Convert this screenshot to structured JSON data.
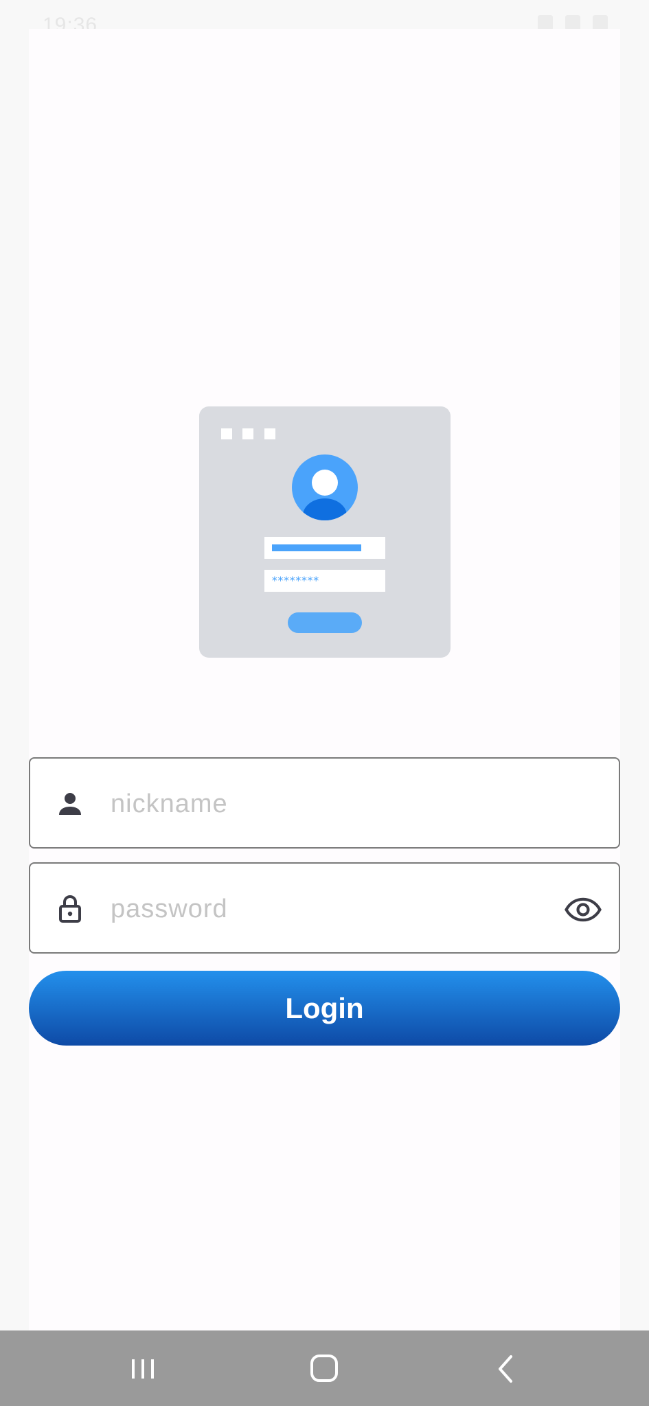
{
  "status_bar": {
    "time": "19:36"
  },
  "illustration": {
    "password_mask": "********"
  },
  "form": {
    "nickname": {
      "placeholder": "nickname",
      "value": "",
      "icon": "person-icon"
    },
    "password": {
      "placeholder": "password",
      "value": "",
      "icon": "lock-icon",
      "toggle_icon": "eye-icon"
    },
    "login_label": "Login"
  },
  "nav_bar": {
    "recents_icon": "recents-icon",
    "home_icon": "home-icon",
    "back_icon": "back-icon"
  },
  "colors": {
    "accent_top": "#2390ec",
    "accent_bottom": "#0e4aa6",
    "illustration_blue": "#4aa3fb",
    "nav_bar": "#9a9a9a"
  }
}
